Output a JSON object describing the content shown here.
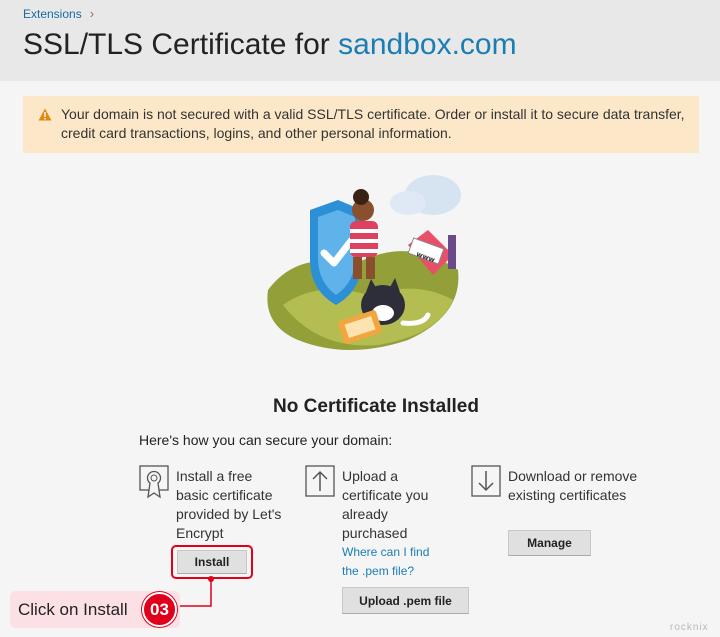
{
  "breadcrumb": {
    "item": "Extensions",
    "separator": "›"
  },
  "title": {
    "prefix": "SSL/TLS Certificate for",
    "domain": "sandbox.com"
  },
  "alert": {
    "text": "Your domain is not secured with a valid SSL/TLS certificate. Order or install it to secure data transfer, credit card transactions, logins, and other personal information.",
    "icon": "warning-icon"
  },
  "illustration": {
    "sign_text": "www"
  },
  "main": {
    "heading": "No Certificate Installed",
    "subheading": "Here's how you can secure your domain:",
    "options": [
      {
        "icon": "certificate-icon",
        "text": "Install a free basic certificate provided by Let's Encrypt",
        "button": "Install"
      },
      {
        "icon": "upload-icon",
        "text": "Upload a certificate you already purchased",
        "link": "Where can I find the .pem file?",
        "button": "Upload .pem file"
      },
      {
        "icon": "download-icon",
        "text": "Download or remove existing certificates",
        "button": "Manage"
      }
    ]
  },
  "annotation": {
    "label": "Click on Install",
    "step": "03"
  },
  "watermark": "rocknix",
  "colors": {
    "accent": "#1a7db4",
    "alert_bg": "#fce8c8",
    "highlight": "#e0001b",
    "callout_bg": "#fbe0e6"
  }
}
